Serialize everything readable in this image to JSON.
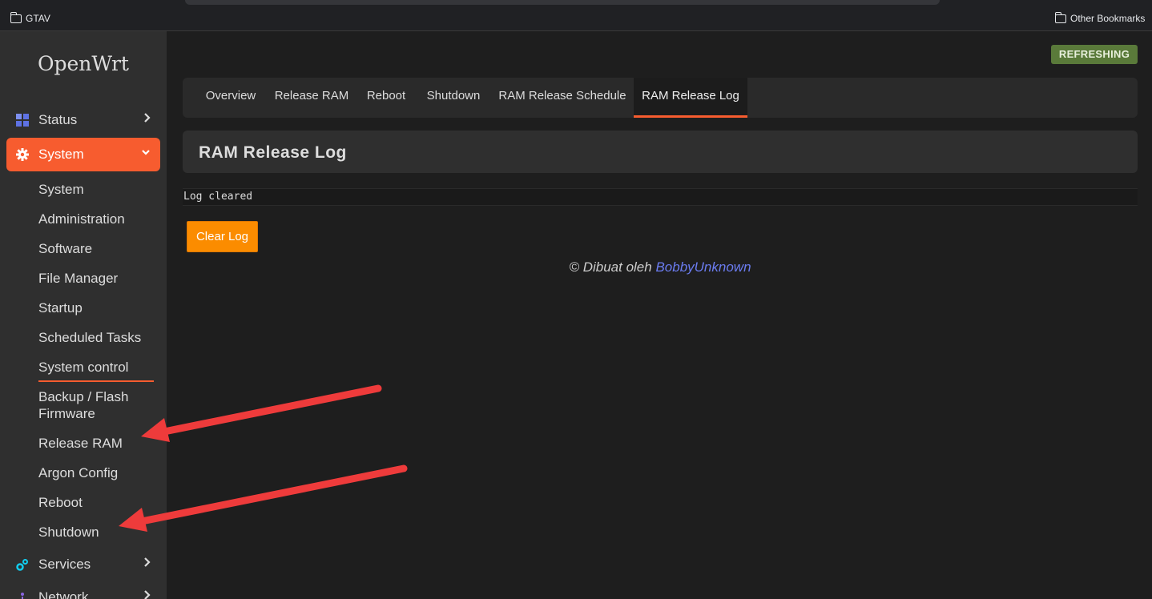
{
  "bookmarks": {
    "left": "GTAV",
    "right": "Other Bookmarks"
  },
  "sidebar": {
    "brand": "OpenWrt",
    "status": "Status",
    "system": "System",
    "sub_items": [
      "System",
      "Administration",
      "Software",
      "File Manager",
      "Startup",
      "Scheduled Tasks",
      "System control",
      "Backup / Flash",
      "Firmware",
      "Release RAM",
      "Argon Config",
      "Reboot",
      "Shutdown"
    ],
    "services": "Services",
    "network": "Network"
  },
  "header": {
    "badge": "REFRESHING"
  },
  "tabs": [
    "Overview",
    "Release RAM",
    "Reboot",
    "Shutdown",
    "RAM Release Schedule",
    "RAM Release Log"
  ],
  "section": {
    "title": "RAM Release Log",
    "log_text": "Log cleared",
    "clear_button": "Clear Log"
  },
  "footer": {
    "prefix": "© Dibuat oleh",
    "author": "BobbyUnknown"
  },
  "colors": {
    "accent": "#f75c2f",
    "button": "#fb8c00",
    "badge": "#5a7a3a",
    "link": "#6b7cf0",
    "arrow": "#ee3b3b"
  }
}
